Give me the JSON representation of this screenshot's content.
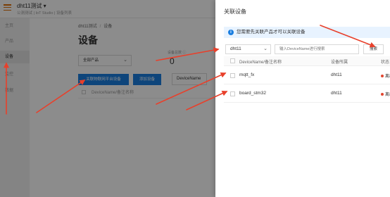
{
  "app": {
    "project_name": "dht11测试",
    "project_sub": "公测测试 | IoT Studio | 设备列表",
    "sidebar": [
      "主页",
      "产品",
      "设备",
      "监控",
      "数据"
    ],
    "breadcrumb": [
      "dht11测试",
      "设备"
    ],
    "title": "设备",
    "product_select": "全部产品",
    "stat_label": "设备总数 ⓘ",
    "stat_value": "0",
    "link_button": "关联物联网平台设备",
    "add_button": "添加设备",
    "filter_label": "DeviceName",
    "table_header": "DeviceName/备注名称"
  },
  "drawer": {
    "title": "关联设备",
    "notice": "您需要先关联产品才可以关联设备",
    "product_select": "dht11",
    "search_placeholder": "输入DeviceName进行搜索",
    "search_button": "搜索",
    "columns": [
      "DeviceName/备注名称",
      "设备所属",
      "状态"
    ],
    "rows": [
      {
        "name": "mqtt_fx",
        "product": "dht11",
        "status": "离线"
      },
      {
        "name": "board_stm32",
        "product": "dht11",
        "status": "离线"
      }
    ]
  },
  "colors": {
    "accent": "#1a7ee0",
    "offline": "#e1462f",
    "arrow": "#e8402b",
    "menu": "#e1710a"
  }
}
